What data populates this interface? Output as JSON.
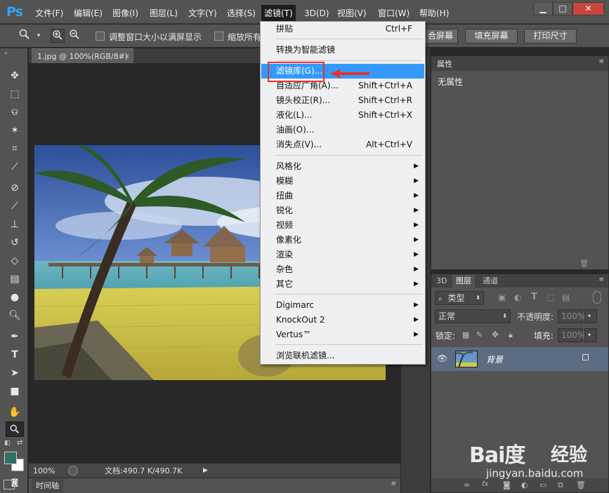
{
  "app": {
    "logo": "Ps",
    "menus": [
      "文件(F)",
      "编辑(E)",
      "图像(I)",
      "图层(L)",
      "文字(Y)",
      "选择(S)",
      "滤镜(T)",
      "3D(D)",
      "视图(V)",
      "窗口(W)",
      "帮助(H)"
    ],
    "active_menu": "滤镜(T)"
  },
  "window_controls": {
    "minimize": "▁",
    "maximize": "□",
    "close": "✕"
  },
  "options_bar": {
    "tool_icon": "zoom-tool-icon",
    "checkbox_resize": "调整窗口大小以满屏显示",
    "checkbox_zoom_all": "缩放所有",
    "btn_fit_partial": "合屏幕",
    "btn_fill_screen": "填充屏幕",
    "btn_print_size": "打印尺寸"
  },
  "document": {
    "tab_title": "1.jpg @ 100%(RGB/8#)",
    "zoom": "100%",
    "doc_info": "文档:490.7 K/490.7K"
  },
  "timeline": {
    "tab": "时间轴"
  },
  "filter_menu": {
    "items": [
      {
        "label": "拼贴",
        "shortcut": "Ctrl+F"
      },
      {
        "label": "转换为智能滤镜",
        "shortcut": ""
      },
      {
        "label": "滤镜库(G)...",
        "shortcut": "",
        "highlighted": true
      },
      {
        "label": "自适应广角(A)...",
        "shortcut": "Shift+Ctrl+A"
      },
      {
        "label": "镜头校正(R)...",
        "shortcut": "Shift+Ctrl+R"
      },
      {
        "label": "液化(L)...",
        "shortcut": "Shift+Ctrl+X"
      },
      {
        "label": "油画(O)...",
        "shortcut": ""
      },
      {
        "label": "消失点(V)...",
        "shortcut": "Alt+Ctrl+V"
      },
      {
        "label": "风格化",
        "submenu": true
      },
      {
        "label": "模糊",
        "submenu": true
      },
      {
        "label": "扭曲",
        "submenu": true
      },
      {
        "label": "锐化",
        "submenu": true
      },
      {
        "label": "视频",
        "submenu": true
      },
      {
        "label": "像素化",
        "submenu": true
      },
      {
        "label": "渲染",
        "submenu": true
      },
      {
        "label": "杂色",
        "submenu": true
      },
      {
        "label": "其它",
        "submenu": true
      },
      {
        "label": "Digimarc",
        "submenu": true
      },
      {
        "label": "KnockOut 2",
        "submenu": true
      },
      {
        "label": "Vertus™",
        "submenu": true
      },
      {
        "label": "浏览联机滤镜...",
        "shortcut": ""
      }
    ]
  },
  "properties_panel": {
    "title": "属性",
    "empty_text": "无属性"
  },
  "layers_panel": {
    "tabs": [
      "3D",
      "图层",
      "通道"
    ],
    "active_tab": "图层",
    "filter_kind": "类型",
    "blend_mode": "正常",
    "opacity_label": "不透明度:",
    "opacity_value": "100%",
    "lock_label": "锁定:",
    "fill_label": "填充:",
    "fill_value": "100%",
    "layer_name": "背景"
  },
  "colors": {
    "foreground": "#2f6f66",
    "background": "#ffffff",
    "menu_highlight": "#3399ff",
    "annotation": "#e8322d"
  },
  "watermark": {
    "logo": "Bai度",
    "cn": "经验",
    "url": "jingyan.baidu.com"
  }
}
